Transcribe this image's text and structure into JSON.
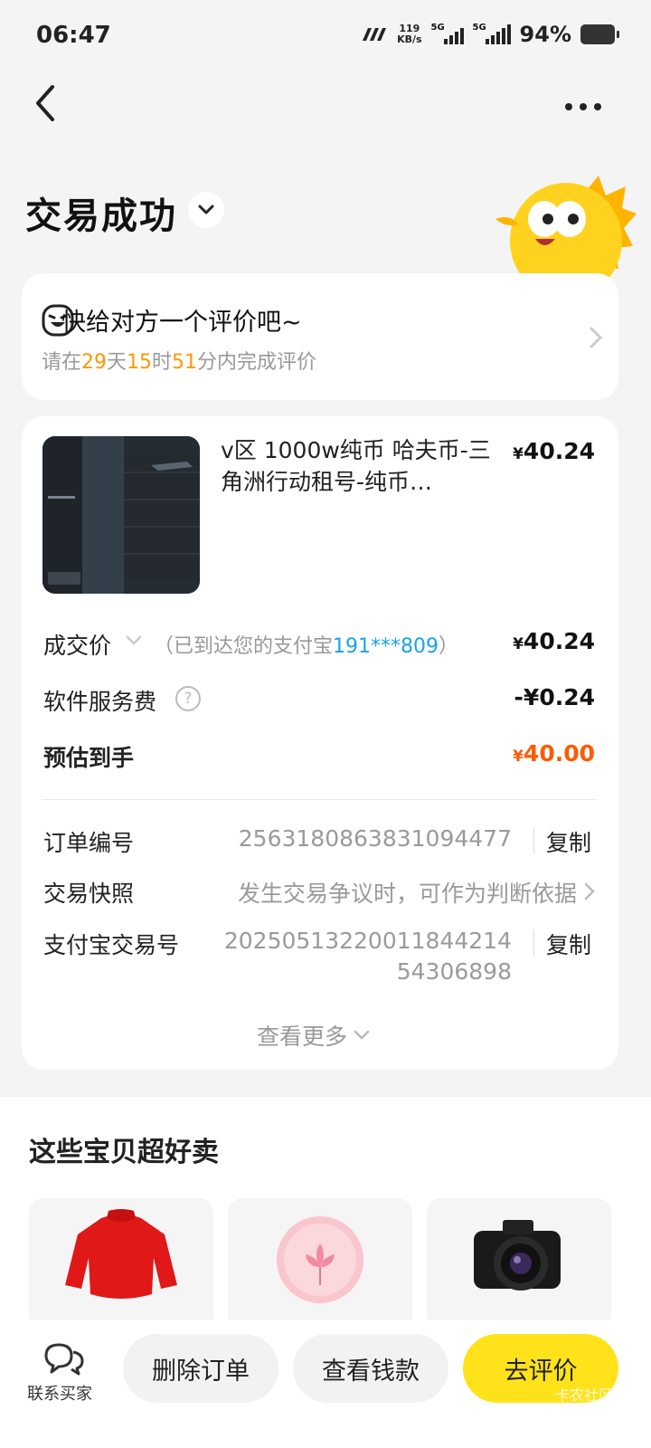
{
  "status_bar": {
    "time": "06:47",
    "net_speed_value": "119",
    "net_speed_unit": "KB/s",
    "signal_1_tag": "5G",
    "signal_2_tag": "5G",
    "battery_percent": "94%"
  },
  "nav": {
    "back_icon": "chevron-left-icon",
    "more_icon": "more-horizontal-icon"
  },
  "order_status": {
    "title": "交易成功",
    "toggle_icon": "chevron-down-icon"
  },
  "review_prompt": {
    "title": "快给对方一个评价吧~",
    "sub_prefix": "请在",
    "days": "29",
    "days_unit": "天",
    "hours": "15",
    "hours_unit": "时",
    "minutes": "51",
    "sub_suffix": "分内完成评价"
  },
  "item": {
    "title": "v区 1000w纯币 哈夫币-三角洲行动租号-纯币…",
    "currency": "¥",
    "price": "40.24"
  },
  "summary": {
    "deal_price_label": "成交价",
    "deal_note_prefix": "（已到达您的支付宝",
    "alipay_account": "191***809",
    "deal_note_suffix": "）",
    "deal_price_currency": "¥",
    "deal_price_value": "40.24",
    "service_fee_label": "软件服务费",
    "service_fee_value": "-¥0.24",
    "estimated_label": "预估到手",
    "estimated_currency": "¥",
    "estimated_value": "40.00"
  },
  "order_info": {
    "order_no_label": "订单编号",
    "order_no": "2563180863831094477",
    "snapshot_label": "交易快照",
    "snapshot_hint": "发生交易争议时，可作为判断依据",
    "alipay_trade_label": "支付宝交易号",
    "alipay_trade_line1": "202505132200118442​14",
    "alipay_trade_line2": "54306898",
    "copy_label": "复制",
    "see_more": "查看更多"
  },
  "recommend": {
    "title": "这些宝贝超好卖",
    "items": [
      "red-sweater",
      "pink-flower-ball",
      "dslr-camera"
    ]
  },
  "bottom_actions": {
    "contact_label": "联系买家",
    "delete_order": "删除订单",
    "view_funds": "查看钱款",
    "go_review": "去评价",
    "watermark": "卡农社区"
  },
  "colors": {
    "accent_yellow": "#ffe21a",
    "countdown_orange": "#ff9800",
    "estimated_red": "#ff5a00",
    "link_blue": "#1aa2e8"
  }
}
